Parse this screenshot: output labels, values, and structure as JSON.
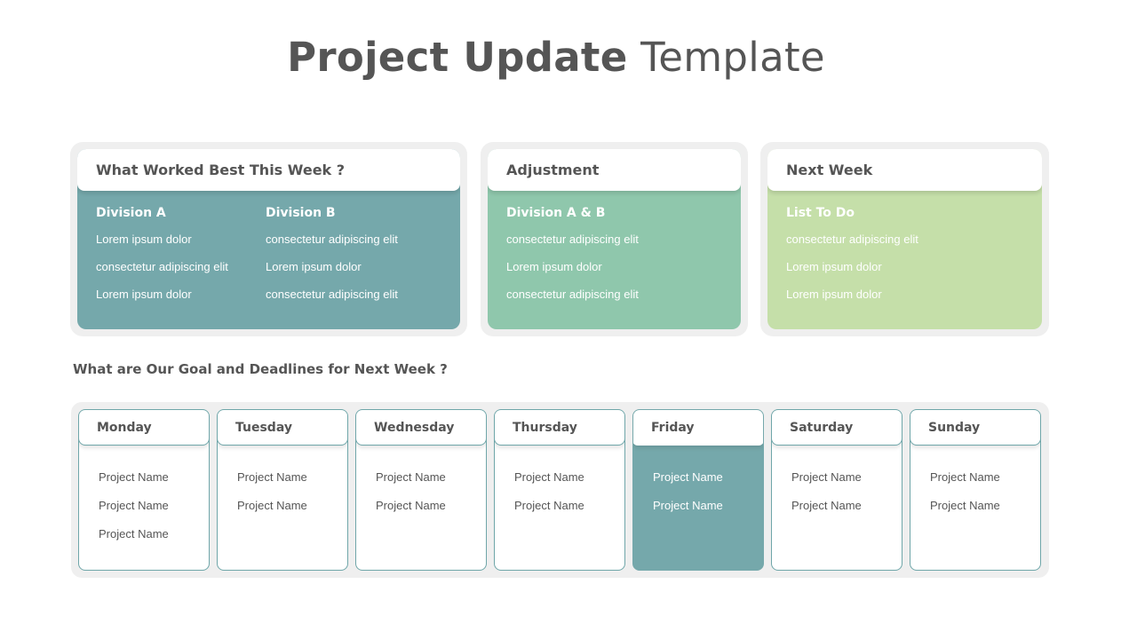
{
  "title": {
    "bold": "Project Update",
    "light": "Template"
  },
  "panels": [
    {
      "heading": "What Worked Best This Week ?",
      "color": "#75a8ab",
      "columns": [
        {
          "heading": "Division A",
          "items": [
            "Lorem ipsum dolor",
            "consectetur adipiscing elit",
            "Lorem ipsum dolor"
          ]
        },
        {
          "heading": "Division B",
          "items": [
            "consectetur adipiscing elit",
            "Lorem ipsum dolor",
            "consectetur adipiscing elit"
          ]
        }
      ]
    },
    {
      "heading": "Adjustment",
      "color": "#8fc7ac",
      "columns": [
        {
          "heading": "Division A & B",
          "items": [
            "consectetur adipiscing elit",
            "Lorem ipsum dolor",
            "consectetur adipiscing elit"
          ]
        }
      ]
    },
    {
      "heading": "Next Week",
      "color": "#c5dfa9",
      "columns": [
        {
          "heading": "List To Do",
          "items": [
            "consectetur adipiscing elit",
            "Lorem ipsum dolor",
            "Lorem ipsum dolor"
          ]
        }
      ]
    }
  ],
  "goals_heading": "What are Our Goal and Deadlines for Next Week ?",
  "days": [
    {
      "name": "Monday",
      "items": [
        "Project Name",
        "Project Name",
        "Project Name"
      ],
      "active": false
    },
    {
      "name": "Tuesday",
      "items": [
        "Project Name",
        "Project Name"
      ],
      "active": false
    },
    {
      "name": "Wednesday",
      "items": [
        "Project Name",
        "Project Name"
      ],
      "active": false
    },
    {
      "name": "Thursday",
      "items": [
        "Project Name",
        "Project Name"
      ],
      "active": false
    },
    {
      "name": "Friday",
      "items": [
        "Project Name",
        "Project Name"
      ],
      "active": true
    },
    {
      "name": "Saturday",
      "items": [
        "Project Name",
        "Project Name"
      ],
      "active": false
    },
    {
      "name": "Sunday",
      "items": [
        "Project Name",
        "Project Name"
      ],
      "active": false
    }
  ],
  "colors": {
    "accent_teal": "#75a8ab",
    "accent_green": "#8fc7ac",
    "accent_lime": "#c5dfa9",
    "text": "#555555"
  }
}
